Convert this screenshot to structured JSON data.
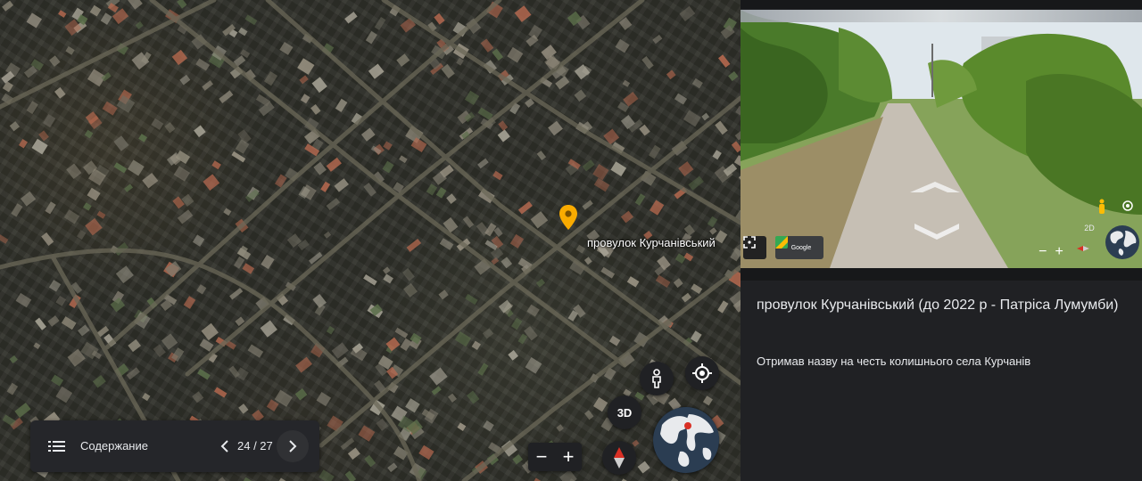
{
  "map": {
    "pin_label": "провулок Курчанівський",
    "btn_3d_label": "3D",
    "zoom_out": "−",
    "zoom_in": "+",
    "icons": [
      "pegman-icon",
      "my-location-icon",
      "compass-icon",
      "globe-icon"
    ]
  },
  "toc": {
    "label": "Содержание",
    "page": "24 / 27"
  },
  "streetview": {
    "zoom_out": "−",
    "zoom_in": "+",
    "mode_label": "2D",
    "icons": [
      "fullscreen-icon",
      "google-thumbnail-icon",
      "pegman-icon",
      "target-icon",
      "compass-icon",
      "globe-icon"
    ],
    "thumb_label": "Google"
  },
  "panel": {
    "title": "провулок Курчанівський (до 2022 р - Патріса Лумумби)",
    "description": "Отримав назву на честь  колишнього села Курчанів"
  },
  "colors": {
    "pin": "#f9ab00",
    "panel_bg": "#202124",
    "compass_red": "#d93025"
  }
}
